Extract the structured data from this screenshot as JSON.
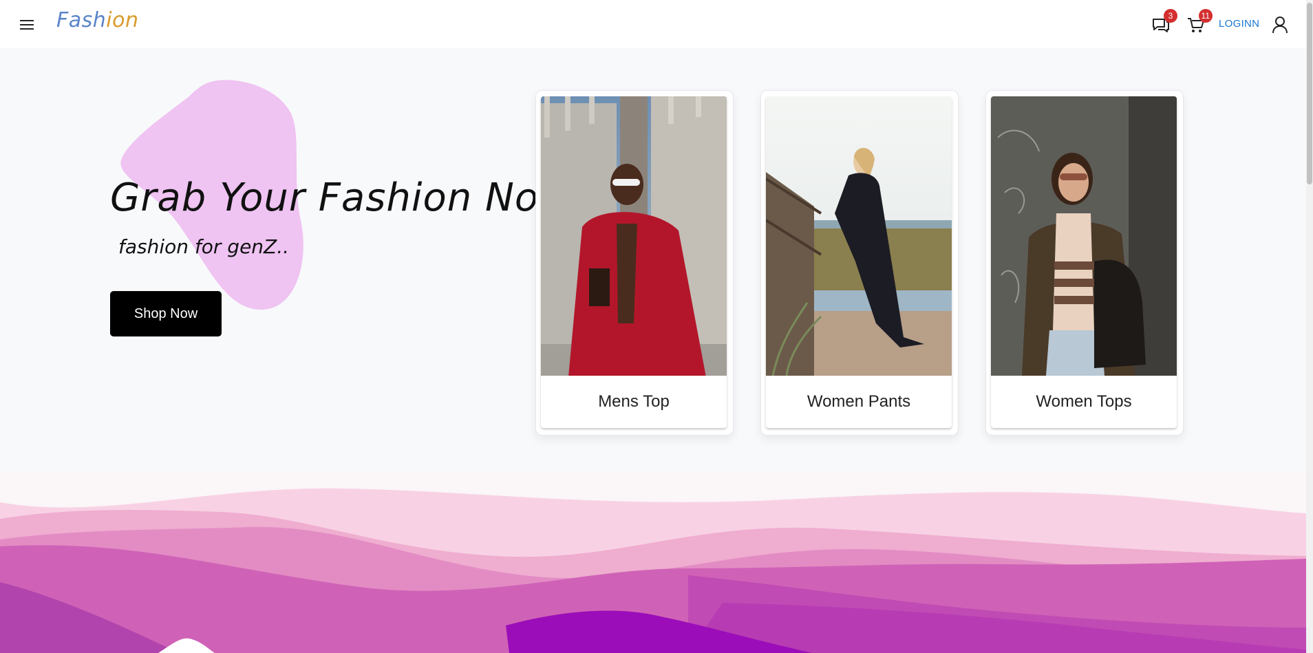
{
  "header": {
    "brand_part1": "Fash",
    "brand_part2": "ion",
    "messages_badge": "3",
    "cart_badge": "11",
    "login_label": "LOGINN",
    "icons": [
      "menu-icon",
      "chat-icon",
      "cart-icon",
      "user-icon"
    ]
  },
  "hero": {
    "title": "Grab Your Fashion Now",
    "subtitle": "fashion for genZ..",
    "cta_label": "Shop Now"
  },
  "categories": [
    {
      "label": "Mens Top"
    },
    {
      "label": "Women Pants"
    },
    {
      "label": "Women Tops"
    }
  ],
  "colors": {
    "accent_blue": "#1976d2",
    "badge_red": "#d32f2f",
    "blob_pink": "#efc3f2",
    "wave_purple": "#9b0db8",
    "brand_blue": "#5b84c9",
    "brand_orange": "#d99b2c"
  }
}
